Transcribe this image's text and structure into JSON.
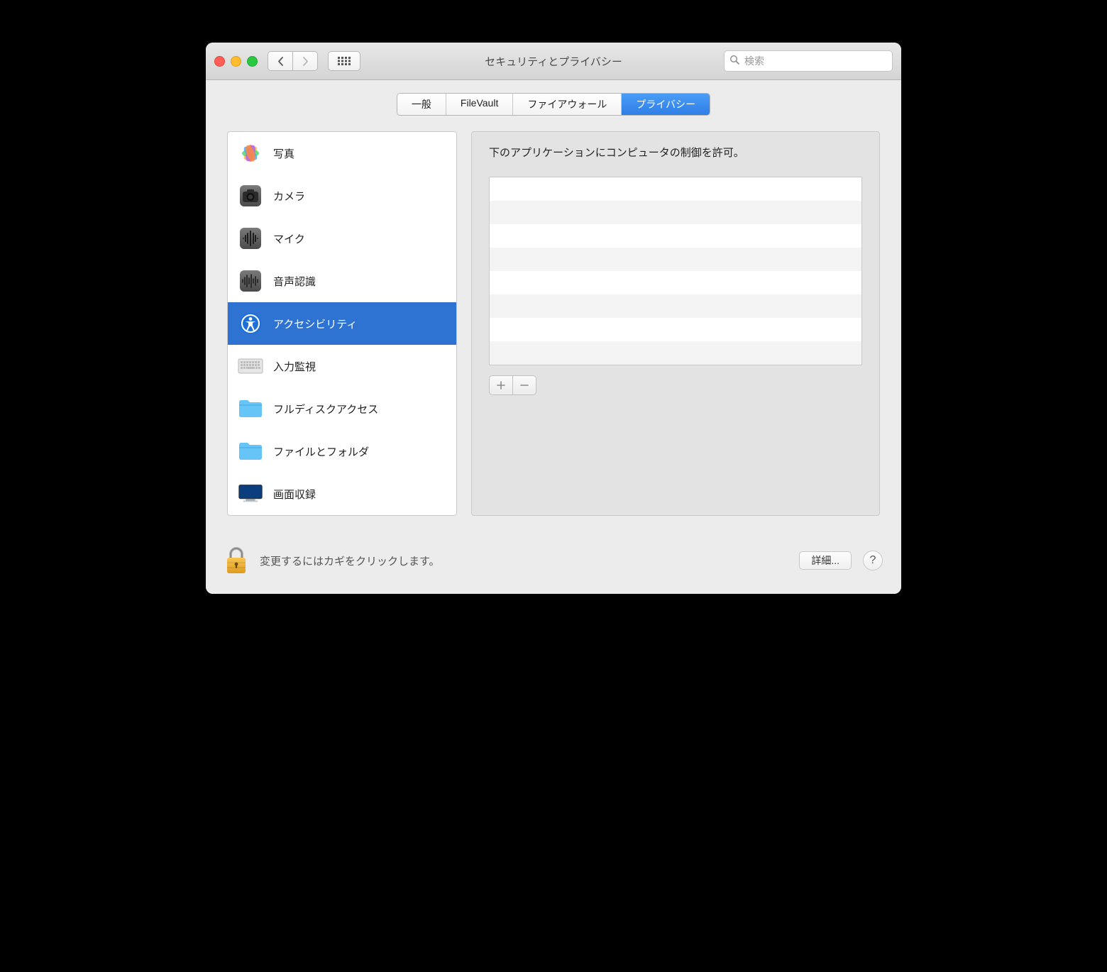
{
  "window": {
    "title": "セキュリティとプライバシー"
  },
  "toolbar": {
    "search_placeholder": "検索"
  },
  "tabs": {
    "general": "一般",
    "filevault": "FileVault",
    "firewall": "ファイアウォール",
    "privacy": "プライバシー",
    "active": "privacy"
  },
  "sidebar": {
    "items": [
      {
        "id": "photos",
        "label": "写真",
        "icon": "photos"
      },
      {
        "id": "camera",
        "label": "カメラ",
        "icon": "camera"
      },
      {
        "id": "microphone",
        "label": "マイク",
        "icon": "microphone"
      },
      {
        "id": "speech",
        "label": "音声認識",
        "icon": "waveform"
      },
      {
        "id": "accessibility",
        "label": "アクセシビリティ",
        "icon": "accessibility"
      },
      {
        "id": "inputmonitor",
        "label": "入力監視",
        "icon": "keyboard"
      },
      {
        "id": "fulldisk",
        "label": "フルディスクアクセス",
        "icon": "folder"
      },
      {
        "id": "filesfolders",
        "label": "ファイルとフォルダ",
        "icon": "folder"
      },
      {
        "id": "screenrec",
        "label": "画面収録",
        "icon": "display"
      }
    ],
    "selected_id": "accessibility"
  },
  "content": {
    "description": "下のアプリケーションにコンピュータの制御を許可。",
    "apps": []
  },
  "footer": {
    "lock_text": "変更するにはカギをクリックします。",
    "advanced": "詳細..."
  }
}
